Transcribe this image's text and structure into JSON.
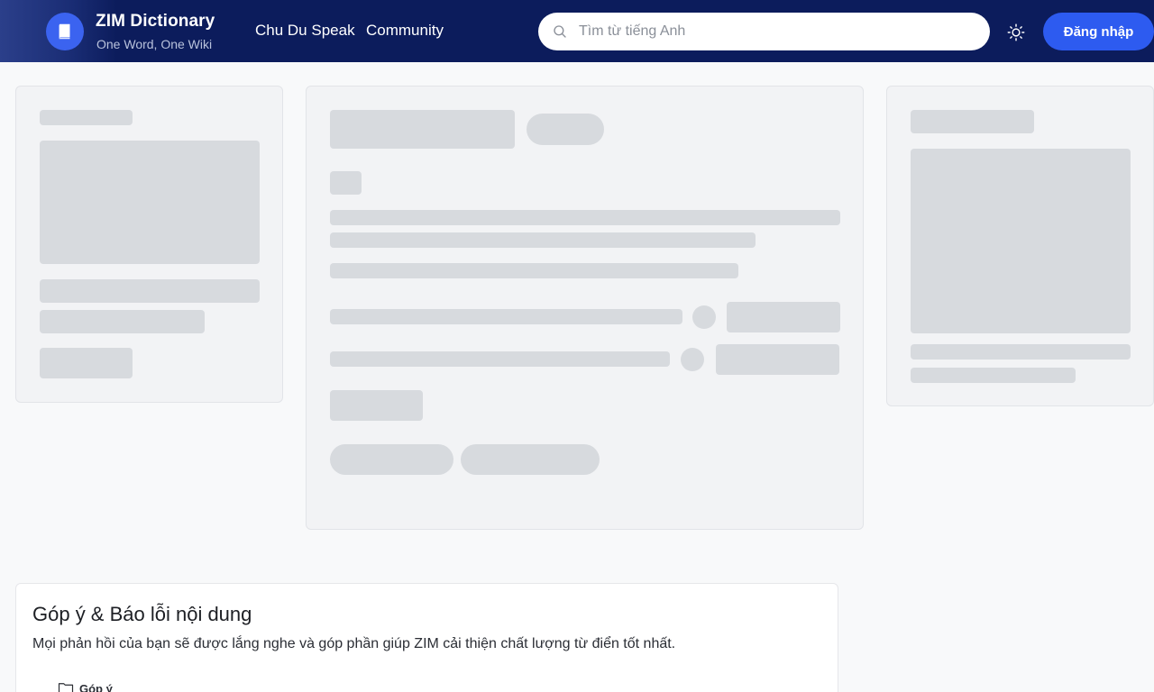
{
  "header": {
    "brand_title": "ZIM Dictionary",
    "brand_subtitle": "One Word, One Wiki",
    "nav": [
      "Chu Du Speak",
      "Community"
    ],
    "search_placeholder": "Tìm từ tiếng Anh",
    "login_label": "Đăng nhập"
  },
  "feedback": {
    "title": "Góp ý & Báo lỗi nội dung",
    "description": "Mọi phản hồi của bạn sẽ được lắng nghe và góp phần giúp ZIM cải thiện chất lượng từ điển tốt nhất.",
    "tab_label": "Góp ý"
  },
  "colors": {
    "header_bg": "#0c1c5c",
    "accent": "#2d5bf0",
    "skeleton": "#d7dade"
  },
  "icons": {
    "logo": "book-icon",
    "search": "search-icon",
    "theme": "sun-icon",
    "tab": "folder-icon"
  }
}
